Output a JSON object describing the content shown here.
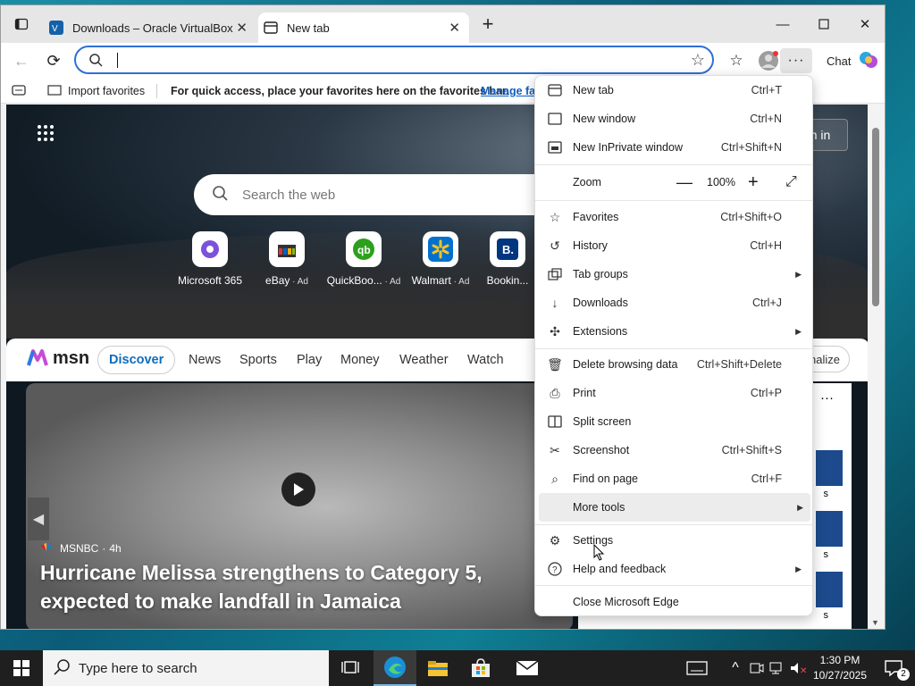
{
  "browser": {
    "tabs": [
      {
        "title": "Downloads – Oracle VirtualBox"
      },
      {
        "title": "New tab"
      }
    ],
    "toolbar": {
      "chat_label": "Chat"
    },
    "favbar": {
      "import_label": "Import favorites",
      "hint": "For quick access, place your favorites here on the favorites bar.",
      "manage_link": "Manage fav"
    }
  },
  "newtab": {
    "search_placeholder": "Search the web",
    "signin_label": "n in",
    "quicklinks": [
      {
        "label": "Microsoft 365",
        "ad": ""
      },
      {
        "label": "eBay",
        "ad": "Ad"
      },
      {
        "label": "QuickBoo...",
        "ad": "Ad"
      },
      {
        "label": "Walmart",
        "ad": "Ad"
      },
      {
        "label": "Bookin...",
        "ad": ""
      }
    ],
    "msn": {
      "logo": "msn",
      "nav": [
        "Discover",
        "News",
        "Sports",
        "Play",
        "Money",
        "Weather",
        "Watch"
      ],
      "personalize": "nalize"
    },
    "story": {
      "source": "MSNBC",
      "age": "4h",
      "headline": "Hurricane Melissa strengthens to Category 5, expected to make landfall in Jamaica"
    },
    "side_snippets": [
      "s",
      "s",
      "s"
    ]
  },
  "menu": {
    "items": [
      {
        "label": "New tab",
        "shortcut": "Ctrl+T"
      },
      {
        "label": "New window",
        "shortcut": "Ctrl+N"
      },
      {
        "label": "New InPrivate window",
        "shortcut": "Ctrl+Shift+N"
      },
      {
        "label": "Zoom",
        "value": "100%"
      },
      {
        "label": "Favorites",
        "shortcut": "Ctrl+Shift+O"
      },
      {
        "label": "History",
        "shortcut": "Ctrl+H"
      },
      {
        "label": "Tab groups",
        "shortcut": ""
      },
      {
        "label": "Downloads",
        "shortcut": "Ctrl+J"
      },
      {
        "label": "Extensions",
        "shortcut": ""
      },
      {
        "label": "Delete browsing data",
        "shortcut": "Ctrl+Shift+Delete"
      },
      {
        "label": "Print",
        "shortcut": "Ctrl+P"
      },
      {
        "label": "Split screen",
        "shortcut": ""
      },
      {
        "label": "Screenshot",
        "shortcut": "Ctrl+Shift+S"
      },
      {
        "label": "Find on page",
        "shortcut": "Ctrl+F"
      },
      {
        "label": "More tools",
        "shortcut": ""
      },
      {
        "label": "Settings",
        "shortcut": ""
      },
      {
        "label": "Help and feedback",
        "shortcut": ""
      },
      {
        "label": "Close Microsoft Edge",
        "shortcut": ""
      }
    ]
  },
  "taskbar": {
    "search_placeholder": "Type here to search",
    "time": "1:30 PM",
    "date": "10/27/2025",
    "notif_count": "2"
  },
  "colors": {
    "accent": "#2f6fd6",
    "msn_blue": "#0f6cbd",
    "taskbar": "#1f1f1f"
  }
}
